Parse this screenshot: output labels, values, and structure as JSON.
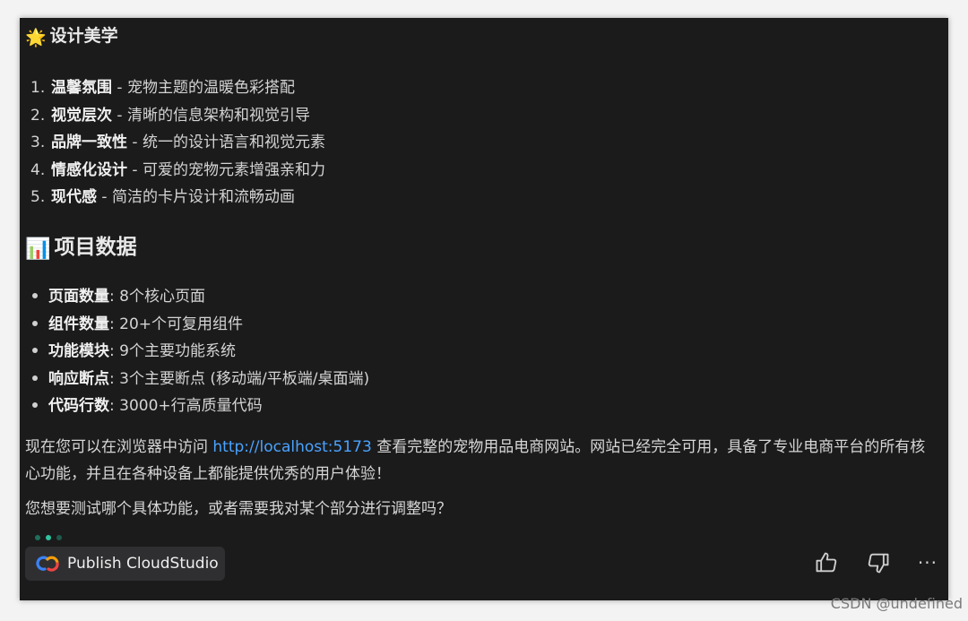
{
  "section1": {
    "emoji": "🌟",
    "heading": "设计美学",
    "items": [
      {
        "num": "1.",
        "bold": "温馨氛围",
        "rest": " - 宠物主题的温暖色彩搭配"
      },
      {
        "num": "2.",
        "bold": "视觉层次",
        "rest": " - 清晰的信息架构和视觉引导"
      },
      {
        "num": "3.",
        "bold": "品牌一致性",
        "rest": " - 统一的设计语言和视觉元素"
      },
      {
        "num": "4.",
        "bold": "情感化设计",
        "rest": " - 可爱的宠物元素增强亲和力"
      },
      {
        "num": "5.",
        "bold": "现代感",
        "rest": " - 简洁的卡片设计和流畅动画"
      }
    ]
  },
  "section2": {
    "emoji": "📊",
    "heading": "项目数据",
    "items": [
      {
        "bold": "页面数量",
        "rest": ": 8个核心页面"
      },
      {
        "bold": "组件数量",
        "rest": ": 20+个可复用组件"
      },
      {
        "bold": "功能模块",
        "rest": ": 9个主要功能系统"
      },
      {
        "bold": "响应断点",
        "rest": ": 3个主要断点 (移动端/平板端/桌面端)"
      },
      {
        "bold": "代码行数",
        "rest": ": 3000+行高质量代码"
      }
    ]
  },
  "paragraph1": {
    "before": "现在您可以在浏览器中访问 ",
    "link": "http://localhost:5173",
    "after": " 查看完整的宠物用品电商网站。网站已经完全可用，具备了专业电商平台的所有核心功能，并且在各种设备上都能提供优秀的用户体验！"
  },
  "paragraph2": "您想要测试哪个具体功能，或者需要我对某个部分进行调整吗？",
  "publish_button": {
    "label": "Publish CloudStudio",
    "icon": "cloudstudio-logo-icon"
  },
  "actions": {
    "icons": [
      "thumbs-up-icon",
      "thumbs-down-icon",
      "more-icon"
    ],
    "more_glyph": "···"
  },
  "watermark": "CSDN @undefined",
  "colors": {
    "panel_bg": "#1b1b1c",
    "link": "#4aa3ff",
    "button_bg": "#2f2f31",
    "dot_active": "#2ec4a0"
  }
}
